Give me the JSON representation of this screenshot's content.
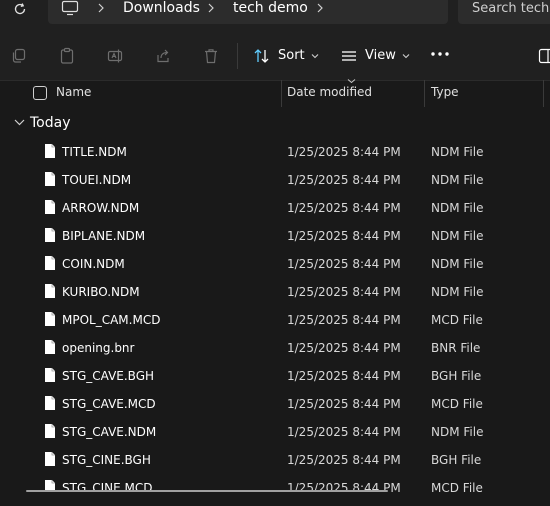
{
  "address": {
    "crumbs": [
      "Downloads",
      "tech demo"
    ],
    "search_placeholder": "Search tech demo"
  },
  "toolbar": {
    "sort_label": "Sort",
    "view_label": "View"
  },
  "columns": {
    "name": "Name",
    "date": "Date modified",
    "type": "Type"
  },
  "group": {
    "label": "Today"
  },
  "files": [
    {
      "name": "TITLE.NDM",
      "date": "1/25/2025 8:44 PM",
      "type": "NDM File"
    },
    {
      "name": "TOUEI.NDM",
      "date": "1/25/2025 8:44 PM",
      "type": "NDM File"
    },
    {
      "name": "ARROW.NDM",
      "date": "1/25/2025 8:44 PM",
      "type": "NDM File"
    },
    {
      "name": "BIPLANE.NDM",
      "date": "1/25/2025 8:44 PM",
      "type": "NDM File"
    },
    {
      "name": "COIN.NDM",
      "date": "1/25/2025 8:44 PM",
      "type": "NDM File"
    },
    {
      "name": "KURIBO.NDM",
      "date": "1/25/2025 8:44 PM",
      "type": "NDM File"
    },
    {
      "name": "MPOL_CAM.MCD",
      "date": "1/25/2025 8:44 PM",
      "type": "MCD File"
    },
    {
      "name": "opening.bnr",
      "date": "1/25/2025 8:44 PM",
      "type": "BNR File"
    },
    {
      "name": "STG_CAVE.BGH",
      "date": "1/25/2025 8:44 PM",
      "type": "BGH File"
    },
    {
      "name": "STG_CAVE.MCD",
      "date": "1/25/2025 8:44 PM",
      "type": "MCD File"
    },
    {
      "name": "STG_CAVE.NDM",
      "date": "1/25/2025 8:44 PM",
      "type": "NDM File"
    },
    {
      "name": "STG_CINE.BGH",
      "date": "1/25/2025 8:44 PM",
      "type": "BGH File"
    },
    {
      "name": "STG_CINE.MCD",
      "date": "1/25/2025 8:44 PM",
      "type": "MCD File"
    }
  ],
  "colors": {
    "background": "#191919",
    "chrome": "#202020",
    "input": "#2c2c2c",
    "text": "#ffffff",
    "muted_text": "#d8d8d8"
  }
}
